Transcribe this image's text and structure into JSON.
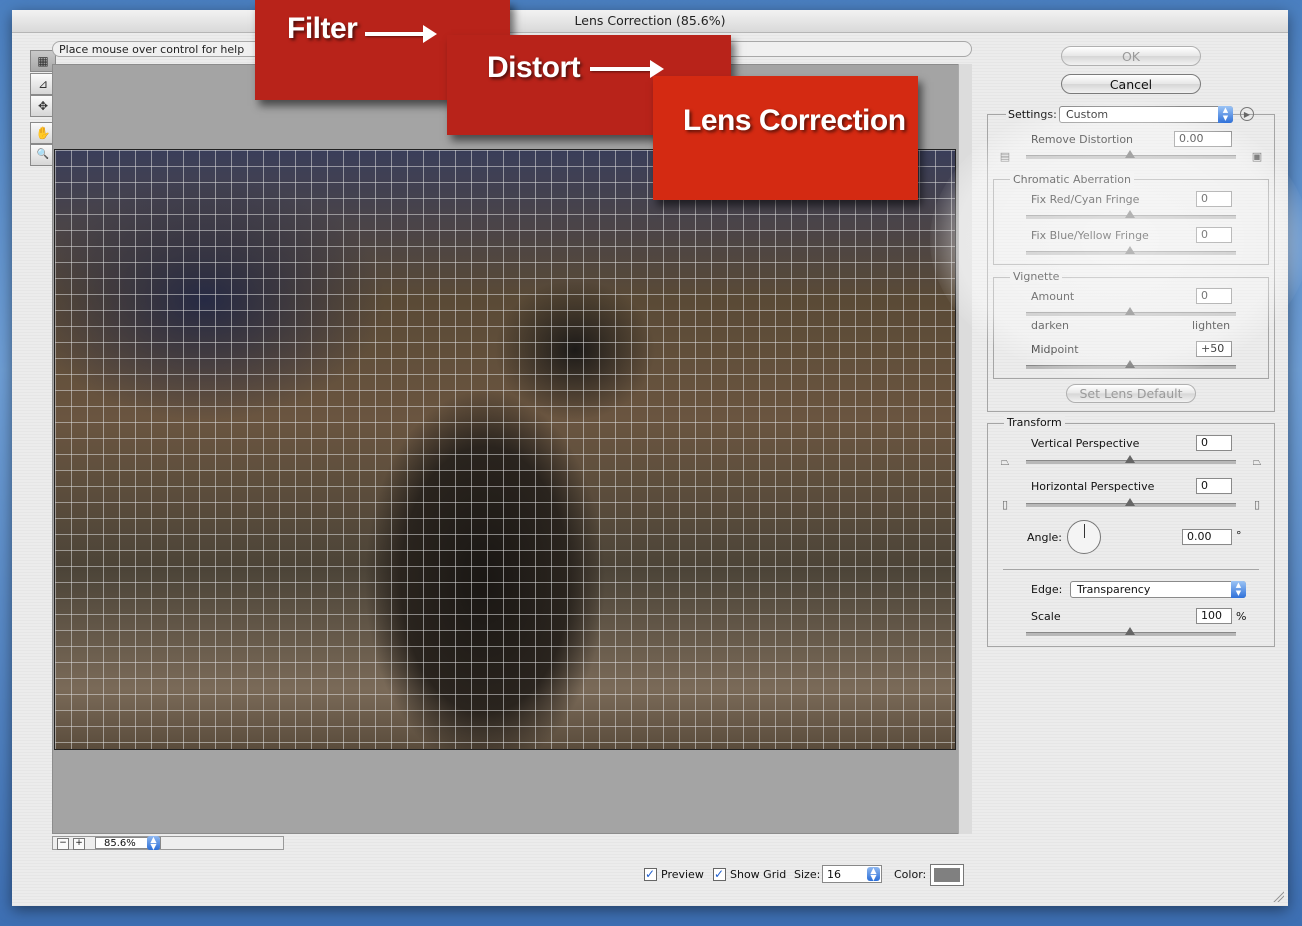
{
  "window": {
    "title": "Lens Correction (85.6%)"
  },
  "toolbar": {
    "tools": [
      {
        "name": "remove-distortion-tool",
        "glyph": "▦"
      },
      {
        "name": "straighten-tool",
        "glyph": "⊿"
      },
      {
        "name": "move-grid-tool",
        "glyph": "✥"
      },
      {
        "name": "hand-tool",
        "glyph": "✋"
      },
      {
        "name": "zoom-tool",
        "glyph": "🔍"
      }
    ]
  },
  "help": {
    "text": "Place mouse over control for help"
  },
  "zoom": {
    "value": "85.6%",
    "minus": "−",
    "plus": "+"
  },
  "bottom": {
    "preview_label": "Preview",
    "show_grid_label": "Show Grid",
    "size_label": "Size:",
    "size_value": "16",
    "color_label": "Color:",
    "grid_color": "#808080"
  },
  "buttons": {
    "ok": "OK",
    "cancel": "Cancel",
    "set_lens_default": "Set Lens Default"
  },
  "settings": {
    "label": "Settings:",
    "value": "Custom",
    "remove_distortion": {
      "label": "Remove Distortion",
      "value": "0.00"
    },
    "chromatic": {
      "title": "Chromatic Aberration",
      "red_cyan": {
        "label": "Fix Red/Cyan Fringe",
        "value": "0"
      },
      "blue_yellow": {
        "label": "Fix Blue/Yellow Fringe",
        "value": "0"
      }
    },
    "vignette": {
      "title": "Vignette",
      "amount": {
        "label": "Amount",
        "value": "0"
      },
      "darken": "darken",
      "lighten": "lighten",
      "midpoint": {
        "label": "Midpoint",
        "value": "+50"
      }
    }
  },
  "transform": {
    "title": "Transform",
    "vertical": {
      "label": "Vertical Perspective",
      "value": "0"
    },
    "horizontal": {
      "label": "Horizontal Perspective",
      "value": "0"
    },
    "angle": {
      "label": "Angle:",
      "value": "0.00",
      "unit": "°"
    },
    "edge": {
      "label": "Edge:",
      "value": "Transparency"
    },
    "scale": {
      "label": "Scale",
      "value": "100",
      "unit": "%"
    }
  },
  "callouts": {
    "filter": "Filter",
    "distort": "Distort",
    "lens_correction": "Lens Correction"
  },
  "colors": {
    "callout_red": "#b8231a",
    "callout_bright_red": "#d42a12",
    "select_blue": "#2f71d9"
  }
}
